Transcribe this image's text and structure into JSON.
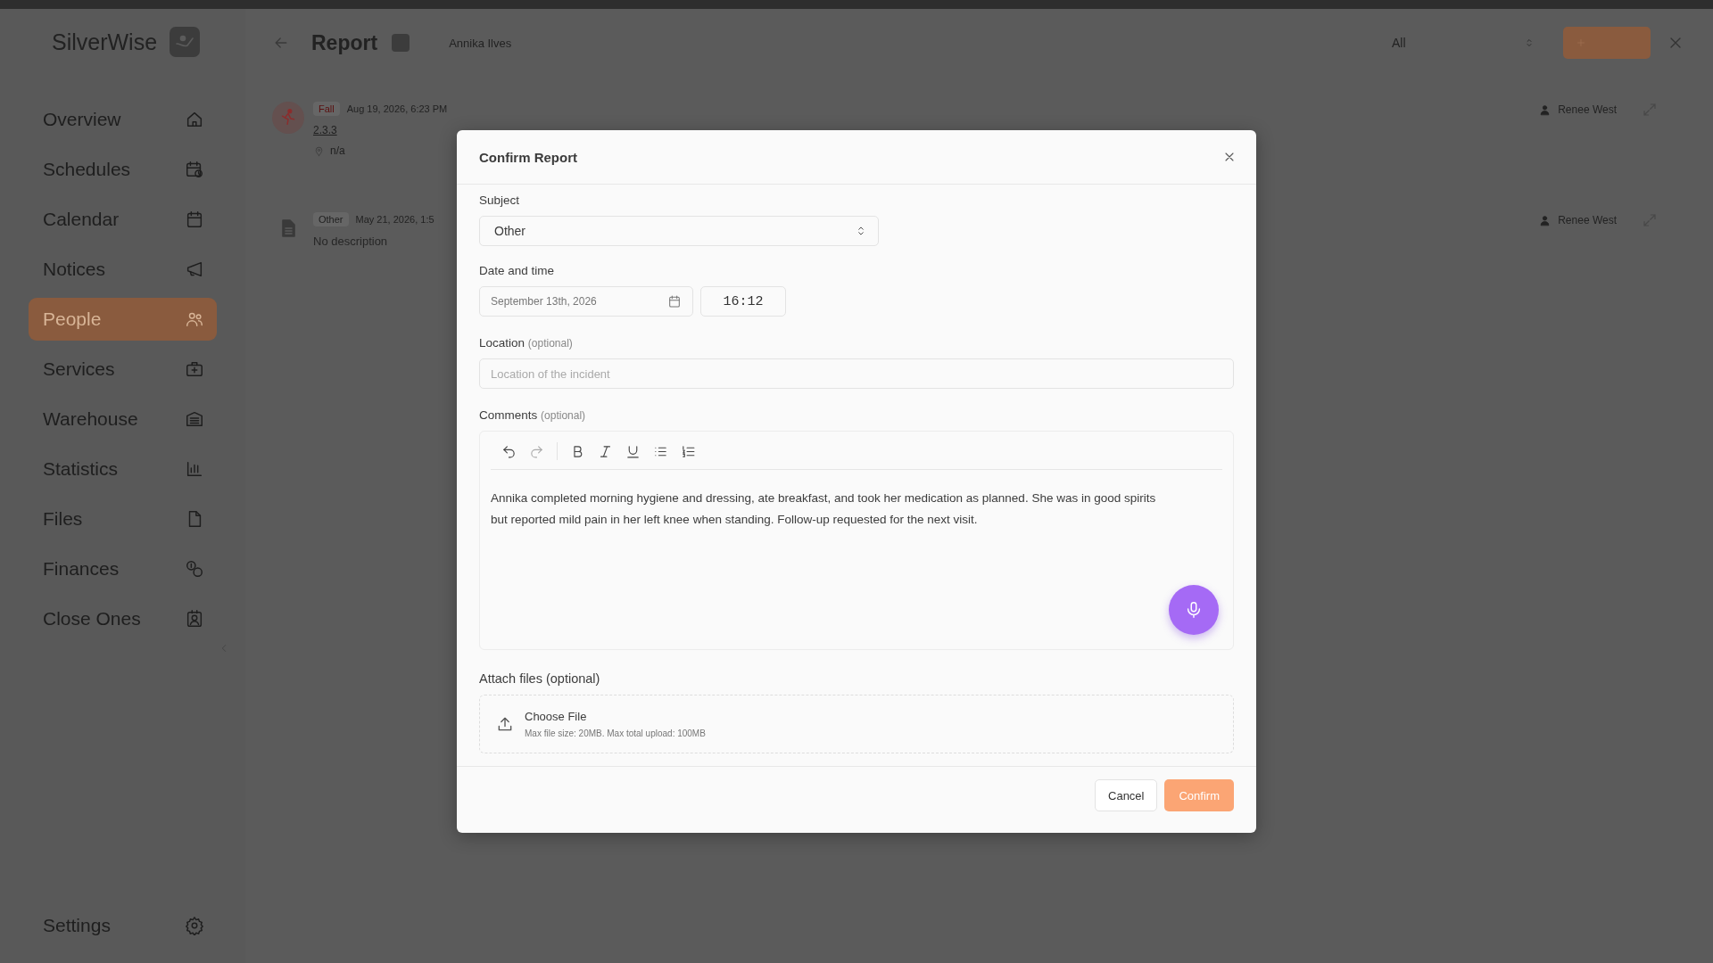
{
  "app": {
    "name": "SilverWise"
  },
  "sidebar": {
    "items": [
      {
        "label": "Overview",
        "selected": false
      },
      {
        "label": "Schedules",
        "selected": false
      },
      {
        "label": "Calendar",
        "selected": false
      },
      {
        "label": "Notices",
        "selected": false
      },
      {
        "label": "People",
        "selected": true
      },
      {
        "label": "Services",
        "selected": false
      },
      {
        "label": "Warehouse",
        "selected": false
      },
      {
        "label": "Statistics",
        "selected": false
      },
      {
        "label": "Files",
        "selected": false
      },
      {
        "label": "Finances",
        "selected": false
      },
      {
        "label": "Close Ones",
        "selected": false
      }
    ],
    "settings": {
      "label": "Settings"
    }
  },
  "header": {
    "title": "Report",
    "person": "Annika Ilves",
    "filter": "All"
  },
  "reports": [
    {
      "kind": "fall",
      "tag": "Fall",
      "date": "Aug 19, 2026, 6:23 PM",
      "description": "2.3.3",
      "location": "n/a",
      "author": "Renee West"
    },
    {
      "kind": "other",
      "tag": "Other",
      "date": "May 21, 2026, 1:5",
      "description": "No description",
      "author": "Renee West"
    }
  ],
  "dialog": {
    "title": "Confirm Report",
    "subject": {
      "label": "Subject",
      "value": "Other"
    },
    "datetime": {
      "label": "Date and time",
      "date": "September 13th, 2026",
      "time": "16:12"
    },
    "location": {
      "label": "Location",
      "optional": "(optional)",
      "placeholder": "Location of the incident"
    },
    "comments": {
      "label": "Comments",
      "optional": "(optional)",
      "text": "Annika completed morning hygiene and dressing, ate breakfast, and took her medication as planned. She was in good spirits but reported mild pain in her left knee when standing. Follow-up requested for the next visit."
    },
    "attach": {
      "label": "Attach files (optional)",
      "button": "Choose File",
      "hint": "Max file size: 20MB. Max total upload: 100MB"
    },
    "buttons": {
      "cancel": "Cancel",
      "confirm": "Confirm"
    }
  }
}
